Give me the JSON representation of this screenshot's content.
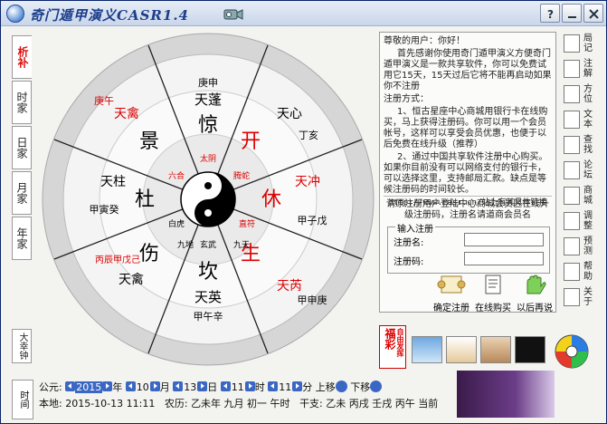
{
  "window": {
    "title": "奇门遁甲演义CASR1.4",
    "icon": "taiji-app-icon",
    "controls": {
      "help": "?",
      "minimize": "minimize",
      "close": "close"
    }
  },
  "left_tabs": [
    "析补",
    "时家",
    "日家",
    "月家",
    "年家"
  ],
  "bottom_tab": "大幸钟",
  "wheel": {
    "center_icon": "yin-yang-icon",
    "gods": [
      "白虎",
      "六合",
      "太阴",
      "腾蛇",
      "直符",
      "九天",
      "九地",
      "玄武"
    ],
    "palaces": [
      {
        "name": "北",
        "heaven_stem": "庚申",
        "star": "天蓬",
        "door": "惊",
        "god": "玄武"
      },
      {
        "name": "东北",
        "heaven_stem": "庚午",
        "star": "天禽",
        "door": "景",
        "god": "白虎"
      },
      {
        "name": "东",
        "heaven_stem": "甲寅癸",
        "star": "天柱",
        "door": "杜",
        "god": "六合"
      },
      {
        "name": "东南",
        "heaven_stem": "丙辰甲戊己",
        "star": "天禽",
        "door": "伤",
        "god": "太阴"
      },
      {
        "name": "南",
        "heaven_stem": "甲午辛",
        "star": "天英",
        "door": "坎",
        "god": "腾蛇"
      },
      {
        "name": "西南",
        "heaven_stem": "甲申庚",
        "star": "天芮",
        "door": "生",
        "god": "直符"
      },
      {
        "name": "西",
        "heaven_stem": "甲子戊",
        "star": "天冲",
        "door": "休",
        "god": "九天"
      },
      {
        "name": "西北",
        "heaven_stem": "丁亥",
        "star": "天心",
        "door": "开",
        "god": "九地"
      }
    ]
  },
  "notice": {
    "greeting": "尊敬的用户：你好！",
    "intro": "首先感谢你使用奇门遁甲演义方便奇门遁甲演义是一款共享软件，你可以免费试用它15天，15天过后它将不能再启动如果你不注册",
    "method_title": "注册方式：",
    "method1": "1、恒古星座中心商城用银行卡在线购买，马上获得注册码。你可以用一个会员帐号，这样可以享受会员优惠，也便于以后免费在线升级（推荐）",
    "method2": "2、通过中国共享软件注册中心购买。如果你目前没有可以网络支付的银行卡，可以选择这里，支持邮局汇款。缺点是等候注册码的时间较长。",
    "url": "http://www.casr.cn/站上有其具体链接"
  },
  "member_note": "请原注册用户登陆中心商城会员区在线升级注册码，注册名请道商会员名",
  "register": {
    "legend": "输入注册",
    "name_label": "注册名:",
    "name_value": "",
    "code_label": "注册码:",
    "code_value": ""
  },
  "actions": [
    {
      "label": "确定注册",
      "icon": "scroll-icon"
    },
    {
      "label": "在线购买",
      "icon": "document-icon"
    },
    {
      "label": "以后再说",
      "icon": "hand-icon"
    }
  ],
  "toolbar": [
    {
      "label": "局记",
      "icon": "book-icon"
    },
    {
      "label": "注解",
      "icon": "notes-icon"
    },
    {
      "label": "方位",
      "icon": "star-icon"
    },
    {
      "label": "文本",
      "icon": "text-icon"
    },
    {
      "label": "查找",
      "icon": "pin-icon"
    },
    {
      "label": "论坛",
      "icon": "forum-icon"
    },
    {
      "label": "商城",
      "icon": "shop-icon"
    },
    {
      "label": "调整",
      "icon": "adjust-icon"
    },
    {
      "label": "预测",
      "icon": "predict-icon"
    },
    {
      "label": "帮助",
      "icon": "help-icon"
    },
    {
      "label": "关于",
      "icon": "about-icon"
    }
  ],
  "fortune": {
    "big": "福彩",
    "small": "自由发挥"
  },
  "date": {
    "solar_label": "公元:",
    "year": "2015",
    "year_unit": "年",
    "month": "10",
    "month_unit": "月",
    "day": "13",
    "day_unit": "日",
    "hour": "11",
    "hour_unit": "时",
    "minute": "11",
    "minute_unit": "分",
    "up": "上移",
    "down": "下移",
    "current": "当前",
    "local_label": "本地:",
    "local_value": "2015-10-13 11:11",
    "lunar_label": "农历:",
    "lunar_value": "乙未年 九月 初一 午时",
    "ganzhi_label": "干支:",
    "ganzhi_value": "乙未 丙戌 壬戌 丙午"
  },
  "time_tab": "时间"
}
